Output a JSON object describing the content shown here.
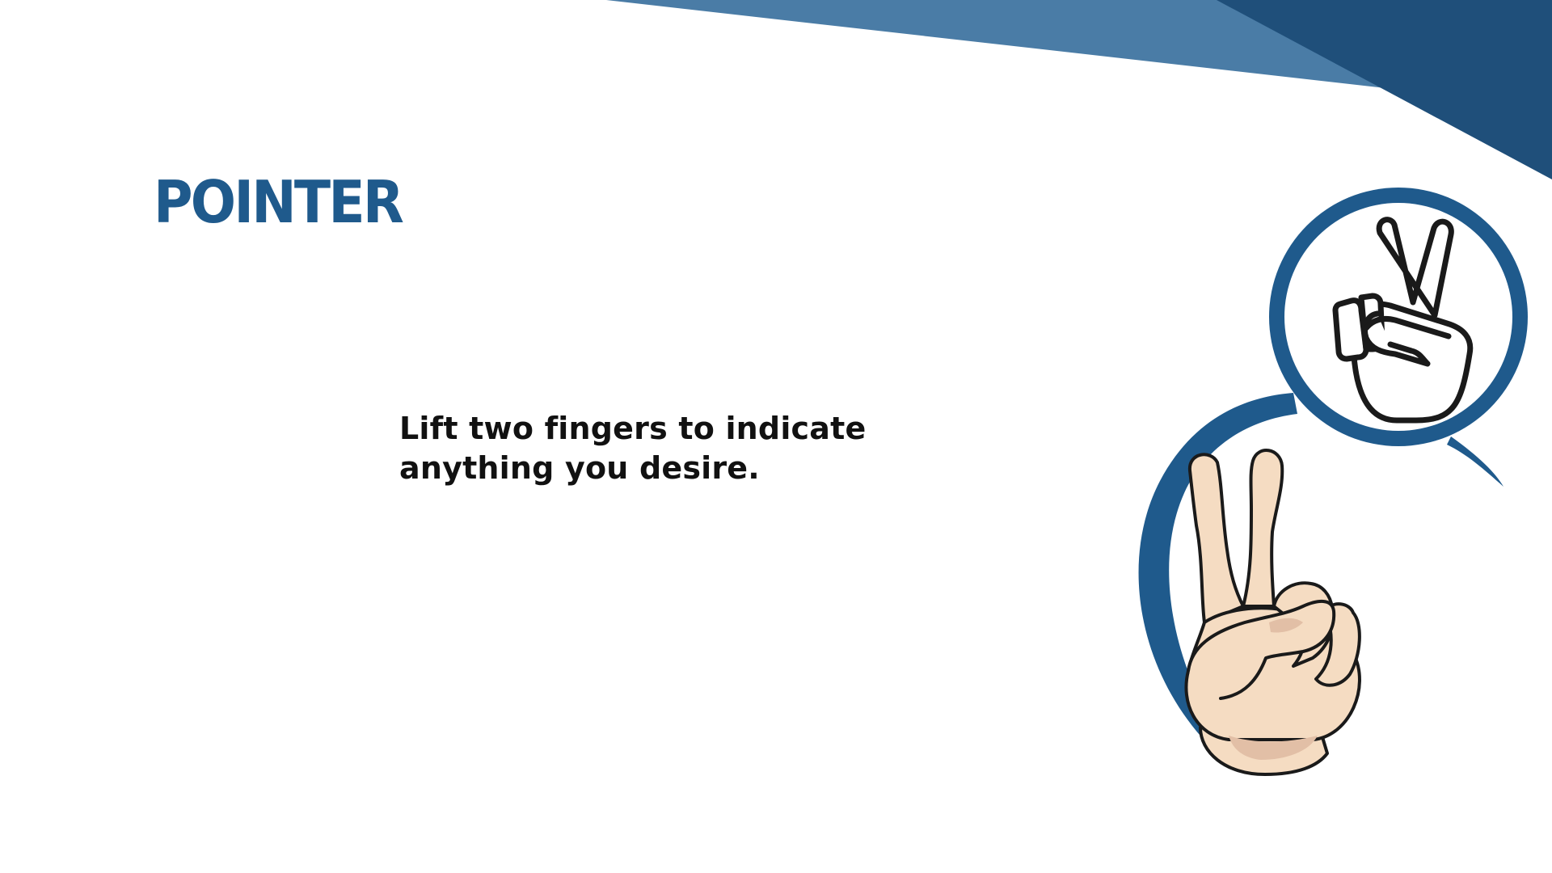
{
  "slide": {
    "title": "POINTER",
    "description": "Lift two fingers to indicate anything you desire."
  },
  "icons": {
    "gesture_icon": "peace-sign-hand-icon",
    "hand_illustration": "two-fingers-raised-hand"
  },
  "colors": {
    "accent_dark_blue": "#1f5a8c",
    "accent_mid_blue": "#4a7ca6",
    "corner_dark_blue": "#1f4f7a",
    "text": "#111111",
    "skin": "#f5dcc2",
    "skin_shadow": "#e2bfa6"
  }
}
